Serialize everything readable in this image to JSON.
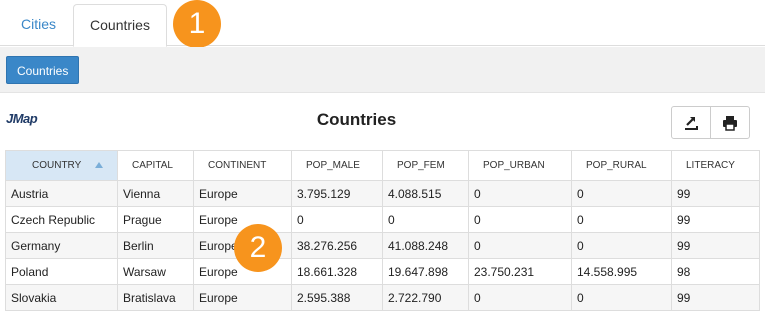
{
  "tabs": [
    {
      "label": "Cities",
      "active": false
    },
    {
      "label": "Countries",
      "active": true
    }
  ],
  "badges": {
    "one": "1",
    "two": "2"
  },
  "toolbar": {
    "countries_button": "Countries"
  },
  "header": {
    "logo": "JMap",
    "title": "Countries"
  },
  "icons": {
    "export": "export-icon",
    "print": "print-icon",
    "sort": "sort-ascending-icon"
  },
  "colors": {
    "accent": "#3a87c8",
    "badge": "#f7941d",
    "sorted_header": "#d7e7f5"
  },
  "table": {
    "columns": [
      "COUNTRY",
      "CAPITAL",
      "CONTINENT",
      "POP_MALE",
      "POP_FEM",
      "POP_URBAN",
      "POP_RURAL",
      "LITERACY"
    ],
    "sorted_column": "COUNTRY",
    "rows": [
      [
        "Austria",
        "Vienna",
        "Europe",
        "3.795.129",
        "4.088.515",
        "0",
        "0",
        "99"
      ],
      [
        "Czech Republic",
        "Prague",
        "Europe",
        "0",
        "0",
        "0",
        "0",
        "99"
      ],
      [
        "Germany",
        "Berlin",
        "Europe",
        "38.276.256",
        "41.088.248",
        "0",
        "0",
        "99"
      ],
      [
        "Poland",
        "Warsaw",
        "Europe",
        "18.661.328",
        "19.647.898",
        "23.750.231",
        "14.558.995",
        "98"
      ],
      [
        "Slovakia",
        "Bratislava",
        "Europe",
        "2.595.388",
        "2.722.790",
        "0",
        "0",
        "99"
      ]
    ]
  }
}
